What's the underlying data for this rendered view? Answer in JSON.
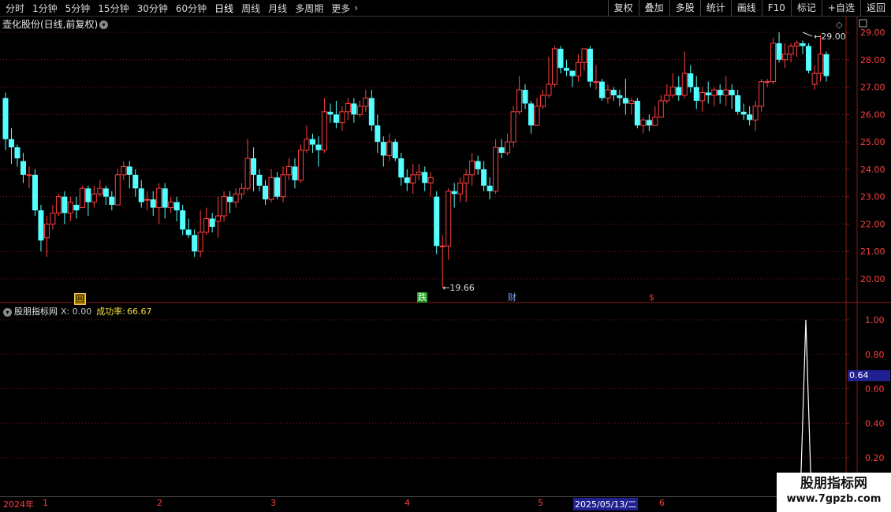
{
  "toolbar": {
    "left_items": [
      "分时",
      "1分钟",
      "5分钟",
      "15分钟",
      "30分钟",
      "60分钟",
      "日线",
      "周线",
      "月线",
      "多周期",
      "更多"
    ],
    "active": "日线",
    "more_icon": "chevron-right-icon",
    "right_buttons": [
      "复权",
      "叠加",
      "多股",
      "统计",
      "画线",
      "F10",
      "标记",
      "+自选",
      "返回"
    ]
  },
  "main_chart": {
    "title": "壶化股份(日线,前复权)",
    "title_icon": "chevron-down-icon",
    "right_icons": [
      "diamond-icon",
      "restore-window-icon"
    ],
    "high_label": "29.00",
    "low_label": "19.66",
    "y_ticks": [
      "29.00",
      "28.00",
      "27.00",
      "26.00",
      "25.00",
      "24.00",
      "23.00",
      "22.00",
      "21.00",
      "20.00"
    ],
    "markers": {
      "hui": "回",
      "zhang": "跌",
      "cai": "财",
      "dollar": "$"
    }
  },
  "indicator": {
    "name": "股朋指标网",
    "x_label": "X: 0.00",
    "success_label": "成功率:",
    "success_value": "66.67",
    "current_value": "0.64",
    "y_ticks": [
      "1.00",
      "0.80",
      "0.60",
      "0.40",
      "0.20"
    ]
  },
  "date_axis": {
    "year": "2024年",
    "months": [
      "1",
      "2",
      "3",
      "4",
      "5",
      "6"
    ],
    "selected_date": "2025/05/13/二"
  },
  "watermark": {
    "line1": "股朋指标网",
    "line2": "www.7gpzb.com"
  },
  "colors": {
    "up": "#ff4040",
    "down": "#54ffff",
    "grid": "#8a1a1a",
    "axis_text": "#ff4040",
    "signal_line": "#ffffff"
  },
  "chart_data": {
    "type": "candlestick",
    "ylim": [
      19.66,
      29.2
    ],
    "candles": [
      [
        26.6,
        25.1,
        26.8,
        24.7
      ],
      [
        25.1,
        24.8,
        25.5,
        24.2
      ],
      [
        24.8,
        24.4,
        24.9,
        24.1
      ],
      [
        24.3,
        23.8,
        24.6,
        23.5
      ],
      [
        23.8,
        23.8,
        24.1,
        23.3
      ],
      [
        23.8,
        22.5,
        24.0,
        22.3
      ],
      [
        22.5,
        21.4,
        22.7,
        21.0
      ],
      [
        21.5,
        22.0,
        22.3,
        20.8
      ],
      [
        22.0,
        22.4,
        22.7,
        21.8
      ],
      [
        22.4,
        23.0,
        23.1,
        22.3
      ],
      [
        23.0,
        22.4,
        23.2,
        22.0
      ],
      [
        22.4,
        22.8,
        23.0,
        22.1
      ],
      [
        22.7,
        22.5,
        23.0,
        22.2
      ],
      [
        22.6,
        23.3,
        23.4,
        22.6
      ],
      [
        23.3,
        22.8,
        23.4,
        22.3
      ],
      [
        22.8,
        23.1,
        23.4,
        22.6
      ],
      [
        23.1,
        23.3,
        23.6,
        23.0
      ],
      [
        23.3,
        23.0,
        23.4,
        22.7
      ],
      [
        23.0,
        22.7,
        23.2,
        22.5
      ],
      [
        22.7,
        23.8,
        24.0,
        22.7
      ],
      [
        23.8,
        24.1,
        24.3,
        23.6
      ],
      [
        24.1,
        23.8,
        24.3,
        23.3
      ],
      [
        23.8,
        23.3,
        24.0,
        23.0
      ],
      [
        23.3,
        22.8,
        23.6,
        22.6
      ],
      [
        22.9,
        22.9,
        23.2,
        22.5
      ],
      [
        22.9,
        22.6,
        23.2,
        22.3
      ],
      [
        22.6,
        23.3,
        23.5,
        22.0
      ],
      [
        23.3,
        22.6,
        23.5,
        22.2
      ],
      [
        22.6,
        22.8,
        23.0,
        22.4
      ],
      [
        22.8,
        22.5,
        23.0,
        22.1
      ],
      [
        22.5,
        21.8,
        22.7,
        21.6
      ],
      [
        21.8,
        21.6,
        22.2,
        21.5
      ],
      [
        21.6,
        21.0,
        21.8,
        20.8
      ],
      [
        21.0,
        21.7,
        22.5,
        20.8
      ],
      [
        21.7,
        22.2,
        22.6,
        21.6
      ],
      [
        22.2,
        21.9,
        22.4,
        21.7
      ],
      [
        22.1,
        22.3,
        23.0,
        21.5
      ],
      [
        22.3,
        23.0,
        23.2,
        22.1
      ],
      [
        23.0,
        22.8,
        23.2,
        22.4
      ],
      [
        22.8,
        23.1,
        23.3,
        22.6
      ],
      [
        23.1,
        23.3,
        23.5,
        22.9
      ],
      [
        23.3,
        24.4,
        25.1,
        23.2
      ],
      [
        24.4,
        23.8,
        24.8,
        23.2
      ],
      [
        23.8,
        23.4,
        24.0,
        23.2
      ],
      [
        23.4,
        22.9,
        23.6,
        22.7
      ],
      [
        22.9,
        23.7,
        24.0,
        22.8
      ],
      [
        23.7,
        23.0,
        23.9,
        22.9
      ],
      [
        23.0,
        23.8,
        24.1,
        22.8
      ],
      [
        23.8,
        24.1,
        24.4,
        23.6
      ],
      [
        24.1,
        23.6,
        24.4,
        23.3
      ],
      [
        23.6,
        24.7,
        24.9,
        23.5
      ],
      [
        24.7,
        25.1,
        25.6,
        24.6
      ],
      [
        25.1,
        24.9,
        25.3,
        24.6
      ],
      [
        24.9,
        24.7,
        25.2,
        24.1
      ],
      [
        24.7,
        26.1,
        26.6,
        24.6
      ],
      [
        26.1,
        26.0,
        26.4,
        25.7
      ],
      [
        26.0,
        25.7,
        26.5,
        25.5
      ],
      [
        25.7,
        26.1,
        26.3,
        25.4
      ],
      [
        26.1,
        26.4,
        26.6,
        25.8
      ],
      [
        26.4,
        26.0,
        26.6,
        25.7
      ],
      [
        26.0,
        26.3,
        26.5,
        25.9
      ],
      [
        26.3,
        26.6,
        26.9,
        26.1
      ],
      [
        26.6,
        25.6,
        26.9,
        25.4
      ],
      [
        25.6,
        25.0,
        26.0,
        24.6
      ],
      [
        25.0,
        24.5,
        25.2,
        24.1
      ],
      [
        24.5,
        25.0,
        25.3,
        24.3
      ],
      [
        25.0,
        24.4,
        25.1,
        24.3
      ],
      [
        24.4,
        23.7,
        24.6,
        23.4
      ],
      [
        23.7,
        23.5,
        24.0,
        23.2
      ],
      [
        23.5,
        23.8,
        24.2,
        23.1
      ],
      [
        23.8,
        23.9,
        24.2,
        23.6
      ],
      [
        23.9,
        23.5,
        24.1,
        23.2
      ],
      [
        23.5,
        23.7,
        23.9,
        23.0
      ],
      [
        23.0,
        21.2,
        23.2,
        20.9
      ],
      [
        21.2,
        21.2,
        21.6,
        19.66
      ],
      [
        21.2,
        23.2,
        23.3,
        20.7
      ],
      [
        23.2,
        23.1,
        23.5,
        22.6
      ],
      [
        23.1,
        23.5,
        23.7,
        22.8
      ],
      [
        23.5,
        23.8,
        24.0,
        22.8
      ],
      [
        23.8,
        24.3,
        24.6,
        23.4
      ],
      [
        24.3,
        24.0,
        24.5,
        23.8
      ],
      [
        24.0,
        23.4,
        24.3,
        23.2
      ],
      [
        23.4,
        23.2,
        23.7,
        22.9
      ],
      [
        23.2,
        24.8,
        25.1,
        23.1
      ],
      [
        24.8,
        24.6,
        25.1,
        24.4
      ],
      [
        24.6,
        25.0,
        25.3,
        24.5
      ],
      [
        25.0,
        26.1,
        26.3,
        24.8
      ],
      [
        26.1,
        26.9,
        27.4,
        26.0
      ],
      [
        26.9,
        26.4,
        27.1,
        26.2
      ],
      [
        26.4,
        25.6,
        26.5,
        25.3
      ],
      [
        25.6,
        26.3,
        26.6,
        25.6
      ],
      [
        26.3,
        26.7,
        26.9,
        26.2
      ],
      [
        26.7,
        27.1,
        28.1,
        26.6
      ],
      [
        27.1,
        28.4,
        28.5,
        27.0
      ],
      [
        28.4,
        27.7,
        28.5,
        27.5
      ],
      [
        27.7,
        27.6,
        28.0,
        27.4
      ],
      [
        27.6,
        27.4,
        27.6,
        27.0
      ],
      [
        27.4,
        27.9,
        28.2,
        27.2
      ],
      [
        27.9,
        28.4,
        28.4,
        27.6
      ],
      [
        28.4,
        27.2,
        28.5,
        27.0
      ],
      [
        27.2,
        27.2,
        27.8,
        26.9
      ],
      [
        27.2,
        26.6,
        27.3,
        26.5
      ],
      [
        26.6,
        26.9,
        27.1,
        26.4
      ],
      [
        26.9,
        26.7,
        27.0,
        26.5
      ],
      [
        26.7,
        26.6,
        26.9,
        26.3
      ],
      [
        26.6,
        26.4,
        27.3,
        26.0
      ],
      [
        26.4,
        26.5,
        26.6,
        26.0
      ],
      [
        26.5,
        25.6,
        26.6,
        25.5
      ],
      [
        25.6,
        25.8,
        25.9,
        25.3
      ],
      [
        25.8,
        25.6,
        26.0,
        25.4
      ],
      [
        25.6,
        25.9,
        26.3,
        25.6
      ],
      [
        25.9,
        26.5,
        26.7,
        25.9
      ],
      [
        26.5,
        26.7,
        27.1,
        26.4
      ],
      [
        26.7,
        27.0,
        27.5,
        26.6
      ],
      [
        27.0,
        26.7,
        27.4,
        26.5
      ],
      [
        26.7,
        27.5,
        28.3,
        26.6
      ],
      [
        27.5,
        27.0,
        27.8,
        26.8
      ],
      [
        27.0,
        26.5,
        27.4,
        26.2
      ],
      [
        26.5,
        26.8,
        27.0,
        26.1
      ],
      [
        26.8,
        26.7,
        27.2,
        26.4
      ],
      [
        26.7,
        26.9,
        27.0,
        26.3
      ],
      [
        26.9,
        26.7,
        27.1,
        26.4
      ],
      [
        26.7,
        26.9,
        27.4,
        26.3
      ],
      [
        26.9,
        26.7,
        27.1,
        26.2
      ],
      [
        26.7,
        26.1,
        26.9,
        26.0
      ],
      [
        26.1,
        26.0,
        26.4,
        25.8
      ],
      [
        26.0,
        25.8,
        26.3,
        25.6
      ],
      [
        25.8,
        26.3,
        26.5,
        25.4
      ],
      [
        26.3,
        27.2,
        27.3,
        26.1
      ],
      [
        27.2,
        27.2,
        27.3,
        27.0
      ],
      [
        27.2,
        28.6,
        28.8,
        27.1
      ],
      [
        28.6,
        28.0,
        29.0,
        27.9
      ],
      [
        28.0,
        28.2,
        28.6,
        27.7
      ],
      [
        28.2,
        28.5,
        28.6,
        27.9
      ],
      [
        28.5,
        28.6,
        28.7,
        28.1
      ],
      [
        28.6,
        28.5,
        28.7,
        28.2
      ],
      [
        28.5,
        27.6,
        28.6,
        27.5
      ],
      [
        27.1,
        27.5,
        27.8,
        26.9
      ],
      [
        27.5,
        28.2,
        28.9,
        27.2
      ],
      [
        28.2,
        27.4,
        28.3,
        27.2
      ]
    ],
    "indicator_series": {
      "name": "股朋指标网",
      "ylim": [
        0,
        1.0
      ],
      "spike_value": 1.0,
      "current": 0.64
    }
  }
}
